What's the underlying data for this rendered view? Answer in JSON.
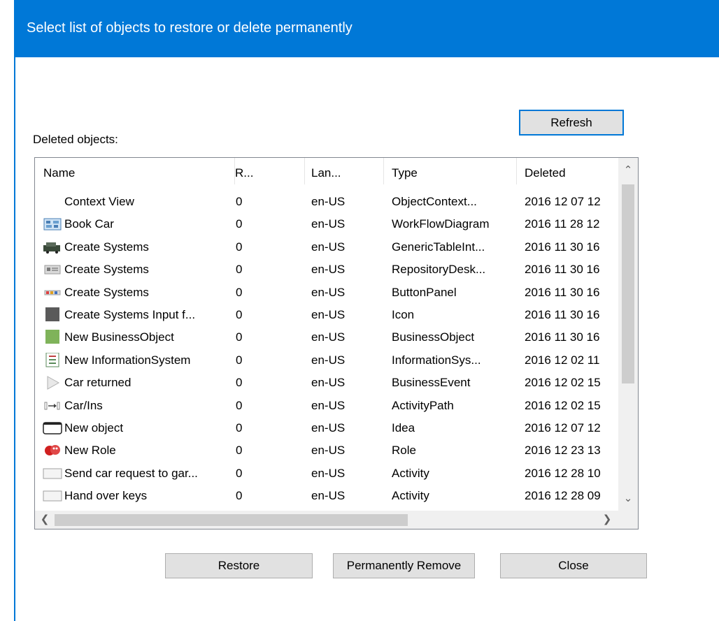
{
  "dialog": {
    "title": "Select list of objects to restore or delete permanently",
    "refresh_label": "Refresh",
    "deleted_label": "Deleted objects:",
    "restore_label": "Restore",
    "remove_label": "Permanently Remove",
    "close_label": "Close"
  },
  "list": {
    "columns": [
      "Name",
      "R...",
      "Lan...",
      "Type",
      "Deleted"
    ],
    "rows": [
      {
        "icon": "none",
        "name": "Context View",
        "r": "0",
        "lang": "en-US",
        "type": "ObjectContext...",
        "deleted": "2016 12 07 12"
      },
      {
        "icon": "workflow-diagram-icon",
        "name": "Book Car",
        "r": "0",
        "lang": "en-US",
        "type": "WorkFlowDiagram",
        "deleted": "2016 11 28 12"
      },
      {
        "icon": "generic-table-icon",
        "name": "Create Systems",
        "r": "0",
        "lang": "en-US",
        "type": "GenericTableInt...",
        "deleted": "2016 11 30 16"
      },
      {
        "icon": "repository-desktop-icon",
        "name": "Create Systems",
        "r": "0",
        "lang": "en-US",
        "type": "RepositoryDesk...",
        "deleted": "2016 11 30 16"
      },
      {
        "icon": "button-panel-icon",
        "name": "Create Systems",
        "r": "0",
        "lang": "en-US",
        "type": "ButtonPanel",
        "deleted": "2016 11 30 16"
      },
      {
        "icon": "gray-square-icon",
        "name": "Create Systems Input f...",
        "r": "0",
        "lang": "en-US",
        "type": "Icon",
        "deleted": "2016 11 30 16"
      },
      {
        "icon": "green-square-icon",
        "name": "New BusinessObject",
        "r": "0",
        "lang": "en-US",
        "type": "BusinessObject",
        "deleted": "2016 11 30 16"
      },
      {
        "icon": "information-system-icon",
        "name": "New InformationSystem",
        "r": "0",
        "lang": "en-US",
        "type": "InformationSys...",
        "deleted": "2016 12 02 11"
      },
      {
        "icon": "business-event-icon",
        "name": "Car returned",
        "r": "0",
        "lang": "en-US",
        "type": "BusinessEvent",
        "deleted": "2016 12 02 15"
      },
      {
        "icon": "activity-path-icon",
        "name": "Car/Ins",
        "r": "0",
        "lang": "en-US",
        "type": "ActivityPath",
        "deleted": "2016 12 02 15"
      },
      {
        "icon": "idea-icon",
        "name": "New object",
        "r": "0",
        "lang": "en-US",
        "type": "Idea",
        "deleted": "2016 12 07 12"
      },
      {
        "icon": "role-masks-icon",
        "name": "New Role",
        "r": "0",
        "lang": "en-US",
        "type": "Role",
        "deleted": "2016 12 23 13"
      },
      {
        "icon": "activity-icon",
        "name": "Send car request to gar...",
        "r": "0",
        "lang": "en-US",
        "type": "Activity",
        "deleted": "2016 12 28 10"
      },
      {
        "icon": "activity-icon",
        "name": "Hand over keys",
        "r": "0",
        "lang": "en-US",
        "type": "Activity",
        "deleted": "2016 12 28 09"
      }
    ]
  },
  "colors": {
    "titlebar": "#0078d7",
    "button_face": "#e1e1e1",
    "focus_border": "#0078d7"
  }
}
